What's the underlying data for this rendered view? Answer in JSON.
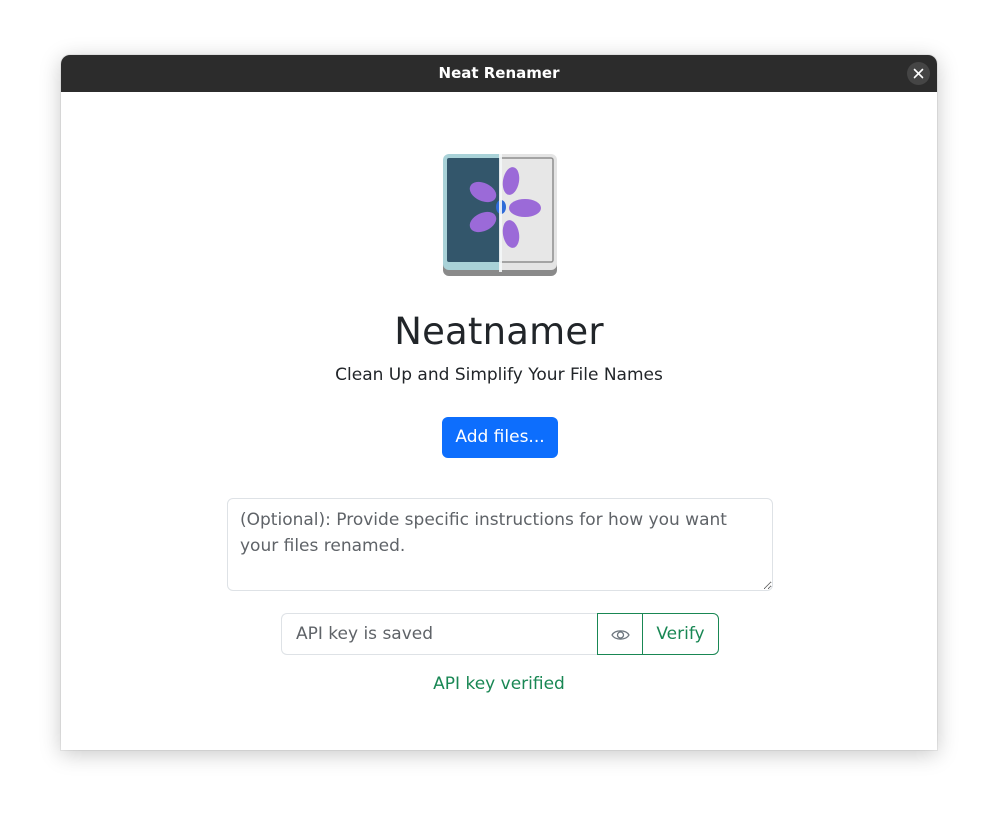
{
  "window": {
    "title": "Neat Renamer",
    "close_icon": "close-icon"
  },
  "app": {
    "name": "Neatnamer",
    "tagline": "Clean Up and Simplify Your File Names",
    "logo_icon": "flower-mirror-icon"
  },
  "actions": {
    "add_files_label": "Add files..."
  },
  "instructions": {
    "placeholder": "(Optional): Provide specific instructions for how you want your files renamed.",
    "value": ""
  },
  "api_key": {
    "placeholder": "API key is saved",
    "value": "",
    "toggle_icon": "eye-icon",
    "verify_label": "Verify",
    "status": "API key verified"
  },
  "colors": {
    "titlebar": "#2c2c2c",
    "primary": "#0d6efd",
    "success": "#198754",
    "logo_petal": "#9b6ad8",
    "logo_dark": "#33566b"
  }
}
